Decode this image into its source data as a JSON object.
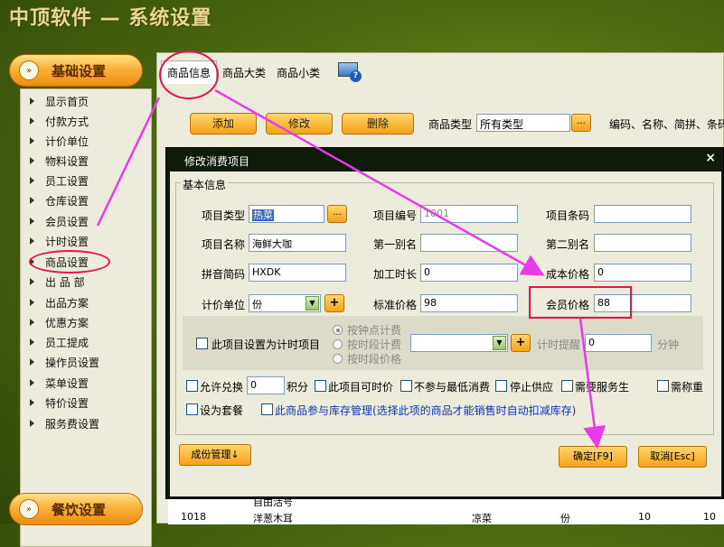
{
  "window": {
    "title": "中顶软件 — 系统设置"
  },
  "sidebar": {
    "section_top": "基础设置",
    "section_bottom": "餐饮设置",
    "items": [
      {
        "label": "显示首页"
      },
      {
        "label": "付款方式"
      },
      {
        "label": "计价单位"
      },
      {
        "label": "物料设置"
      },
      {
        "label": "员工设置"
      },
      {
        "label": "仓库设置"
      },
      {
        "label": "会员设置"
      },
      {
        "label": "计时设置"
      },
      {
        "label": "商品设置"
      },
      {
        "label": "出 品 部"
      },
      {
        "label": "出品方案"
      },
      {
        "label": "优惠方案"
      },
      {
        "label": "员工提成"
      },
      {
        "label": "操作员设置"
      },
      {
        "label": "菜单设置"
      },
      {
        "label": "特价设置"
      },
      {
        "label": "服务费设置"
      }
    ]
  },
  "main": {
    "tabs": [
      {
        "label": "商品信息"
      },
      {
        "label": "商品大类"
      },
      {
        "label": "商品小类"
      }
    ],
    "toolbar": {
      "add": "添加",
      "edit": "修改",
      "delete": "删除",
      "type_label": "商品类型",
      "type_value": "所有类型",
      "dots": "...",
      "search_hint": "编码、名称、简拼、条码"
    },
    "table_row_top": {
      "name": "自由活号"
    },
    "table_row": {
      "code": "1018",
      "name": "洋葱木耳",
      "category": "凉菜",
      "unit": "份",
      "qty": "10",
      "price": "10"
    }
  },
  "dialog": {
    "title": "修改消费项目",
    "close": "×",
    "group_title": "基本信息",
    "fields": {
      "item_type_label": "项目类型",
      "item_type_value": "热菜",
      "item_code_label": "项目编号",
      "item_code_value": "1001",
      "barcode_label": "项目条码",
      "barcode_value": "",
      "item_name_label": "项目名称",
      "item_name_value": "海鲜大咖",
      "alias1_label": "第一别名",
      "alias1_value": "",
      "alias2_label": "第二别名",
      "alias2_value": "",
      "pinyin_label": "拼音简码",
      "pinyin_value": "HXDK",
      "process_time_label": "加工时长",
      "process_time_value": "0",
      "cost_price_label": "成本价格",
      "cost_price_value": "0",
      "unit_label": "计价单位",
      "unit_value": "份",
      "std_price_label": "标准价格",
      "std_price_value": "98",
      "member_price_label": "会员价格",
      "member_price_value": "88"
    },
    "timer": {
      "checkbox_label": "此项目设置为计时项目",
      "radio_points": "按钟点计费",
      "radio_period_fee": "按时段计费",
      "radio_period_price": "按时段价格",
      "reminder_label": "计时提醒",
      "reminder_value": "0",
      "minutes": "分钟"
    },
    "options": {
      "exchange_label": "允许兑换",
      "exchange_value": "0",
      "points": "积分",
      "time_price": "此项目可时价",
      "no_min_consume": "不参与最低消费",
      "stop_supply": "停止供应",
      "need_waiter": "需要服务生",
      "need_weigh": "需称重",
      "set_meal": "设为套餐",
      "stock_mgmt": "此商品参与库存管理(选择此项的商品才能销售时自动扣减库存)"
    },
    "buttons": {
      "components": "成份管理↓",
      "ok": "确定[F9]",
      "cancel": "取消[Esc]"
    }
  },
  "colors": {
    "annotation": "#e8134e",
    "arrow": "#e83ae8",
    "button_orange": "#f5a219",
    "background_green": "#4e6a10"
  }
}
